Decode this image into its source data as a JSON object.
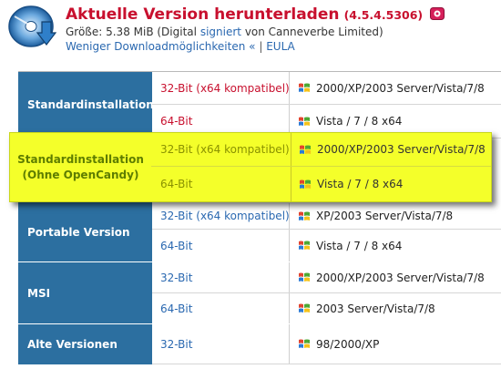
{
  "header": {
    "title": "Aktuelle Version herunterladen",
    "version": "(4.5.4.5306)",
    "size_prefix": "Größe: 5.38 MiB (Digital",
    "signed_link": "signiert",
    "size_suffix": "von Canneverbe Limited)",
    "more_link": "Weniger Downloadmöglichkeiten «",
    "separator": "|",
    "eula_link": "EULA"
  },
  "table": {
    "groups": [
      {
        "label": "Standardinstallation",
        "rows": [
          {
            "bit": "32-Bit (x64 kompatibel)",
            "os": "2000/XP/2003 Server/Vista/7/8",
            "active": true
          },
          {
            "bit": "64-Bit",
            "os": "Vista / 7 / 8 x64",
            "active": true
          }
        ]
      },
      {
        "label_line1": "Standardinstallation",
        "label_line2": "(Ohne OpenCandy)",
        "rows": [
          {
            "bit": "32-Bit (x64 kompatibel)",
            "os": "2000/XP/2003 Server/Vista/7/8"
          },
          {
            "bit": "64-Bit",
            "os": "Vista / 7 / 8 x64"
          }
        ]
      },
      {
        "label": "Portable Version",
        "rows": [
          {
            "bit": "32-Bit (x64 kompatibel)",
            "os": "XP/2003 Server/Vista/7/8"
          },
          {
            "bit": "64-Bit",
            "os": "Vista / 7 / 8 x64"
          }
        ]
      },
      {
        "label": "MSI",
        "rows": [
          {
            "bit": "32-Bit",
            "os": "2000/XP/2003 Server/Vista/7/8"
          },
          {
            "bit": "64-Bit",
            "os": "2003 Server/Vista/7/8"
          }
        ]
      },
      {
        "label": "Alte Versionen",
        "rows": [
          {
            "bit": "32-Bit",
            "os": "98/2000/XP"
          }
        ]
      }
    ]
  },
  "colors": {
    "title_red": "#c8102e",
    "link_blue": "#2a68b0",
    "label_blue": "#2c6fa0",
    "highlight_yellow": "#f4ff2a"
  },
  "icons": [
    "cd-disc-download-logo",
    "candy-badge-icon",
    "windows-flag-icon"
  ]
}
